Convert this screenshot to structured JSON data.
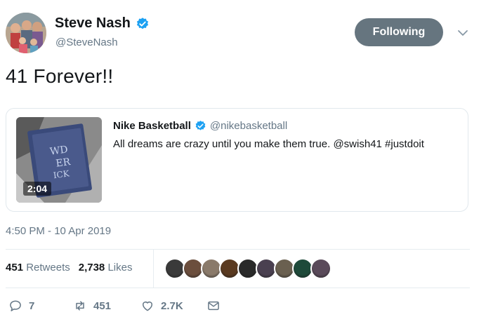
{
  "author": {
    "name": "Steve Nash",
    "handle": "@SteveNash",
    "verified": true
  },
  "follow_button_label": "Following",
  "tweet_text": "41 Forever!!",
  "quoted": {
    "name": "Nike Basketball",
    "handle": "@nikebasketball",
    "verified": true,
    "text": "All dreams are crazy until you make them true. @swish41 #justdoit",
    "video_duration": "2:04"
  },
  "timestamp": "4:50 PM - 10 Apr 2019",
  "stats": {
    "retweets_count": "451",
    "retweets_label": "Retweets",
    "likes_count": "2,738",
    "likes_label": "Likes"
  },
  "liker_avatars": [
    "#3a3a3a",
    "#6b4e3d",
    "#8a7a6a",
    "#5a3a20",
    "#2a2a2a",
    "#4a4050",
    "#6a6050",
    "#1e4a3a",
    "#5a4a5a"
  ],
  "actions": {
    "replies": "7",
    "retweets": "451",
    "likes": "2.7K"
  },
  "colors": {
    "verified_blue": "#1da1f2",
    "follow_button_bg": "#66757f",
    "secondary_text": "#657786"
  }
}
